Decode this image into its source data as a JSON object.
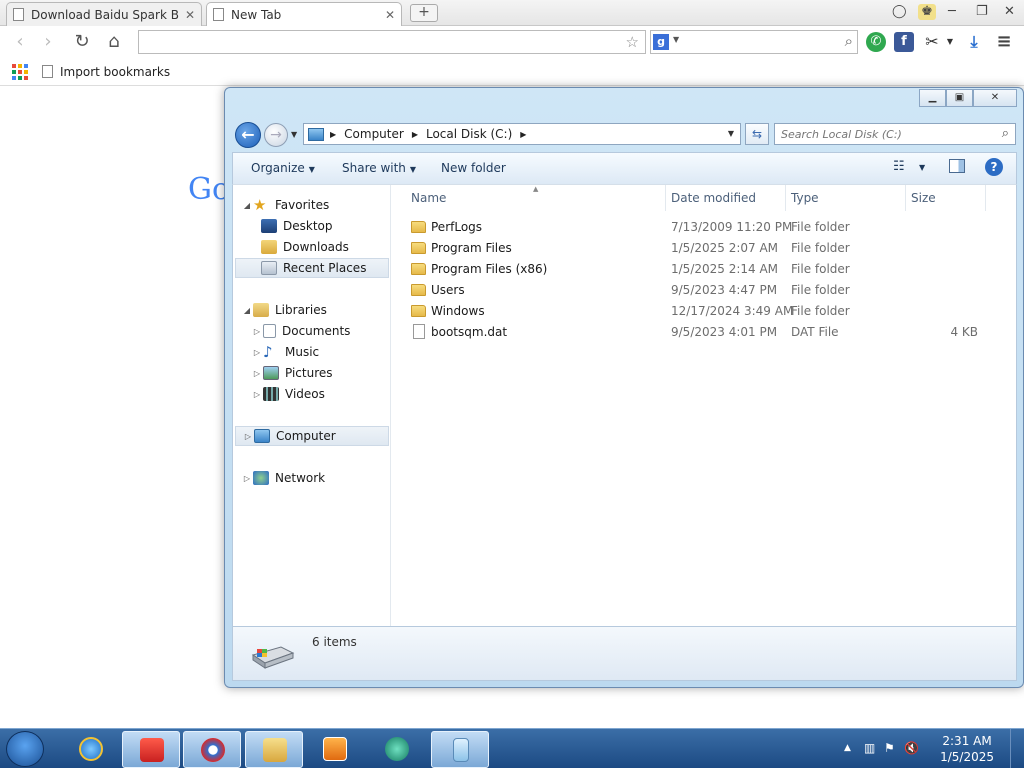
{
  "browser": {
    "tabs": [
      {
        "label": "Download Baidu Spark Bro",
        "active": false
      },
      {
        "label": "New Tab",
        "active": true
      }
    ],
    "new_tab_label": "+",
    "window_controls": {
      "minimize": "─",
      "restore": "❐",
      "close": "✕"
    },
    "omnibox": {
      "value": ""
    },
    "search_engine_badge": "g",
    "bookmarks": [
      {
        "label": "Import bookmarks"
      }
    ],
    "page_fragment": "Go"
  },
  "explorer": {
    "address": {
      "segments": [
        "Computer",
        "Local Disk (C:)"
      ]
    },
    "search_placeholder": "Search Local Disk (C:)",
    "commands": {
      "organize": "Organize",
      "share": "Share with",
      "new_folder": "New folder"
    },
    "nav": {
      "favorites": "Favorites",
      "desktop": "Desktop",
      "downloads": "Downloads",
      "recent": "Recent Places",
      "libraries": "Libraries",
      "documents": "Documents",
      "music": "Music",
      "pictures": "Pictures",
      "videos": "Videos",
      "computer": "Computer",
      "network": "Network"
    },
    "columns": {
      "name": "Name",
      "date": "Date modified",
      "type": "Type",
      "size": "Size"
    },
    "files": [
      {
        "name": "PerfLogs",
        "date": "7/13/2009 11:20 PM",
        "type": "File folder",
        "size": "",
        "kind": "folder"
      },
      {
        "name": "Program Files",
        "date": "1/5/2025 2:07 AM",
        "type": "File folder",
        "size": "",
        "kind": "folder"
      },
      {
        "name": "Program Files (x86)",
        "date": "1/5/2025 2:14 AM",
        "type": "File folder",
        "size": "",
        "kind": "folder"
      },
      {
        "name": "Users",
        "date": "9/5/2023 4:47 PM",
        "type": "File folder",
        "size": "",
        "kind": "folder"
      },
      {
        "name": "Windows",
        "date": "12/17/2024 3:49 AM",
        "type": "File folder",
        "size": "",
        "kind": "folder"
      },
      {
        "name": "bootsqm.dat",
        "date": "9/5/2023 4:01 PM",
        "type": "DAT File",
        "size": "4 KB",
        "kind": "file"
      }
    ],
    "status": "6 items"
  },
  "taskbar": {
    "clock_time": "2:31 AM",
    "clock_date": "1/5/2025"
  },
  "colors": {
    "accent": "#1d5fb8",
    "taskbar": "#1c4a83",
    "folder": "#e6b94a",
    "explorer_frame": "#bcd9ef"
  }
}
